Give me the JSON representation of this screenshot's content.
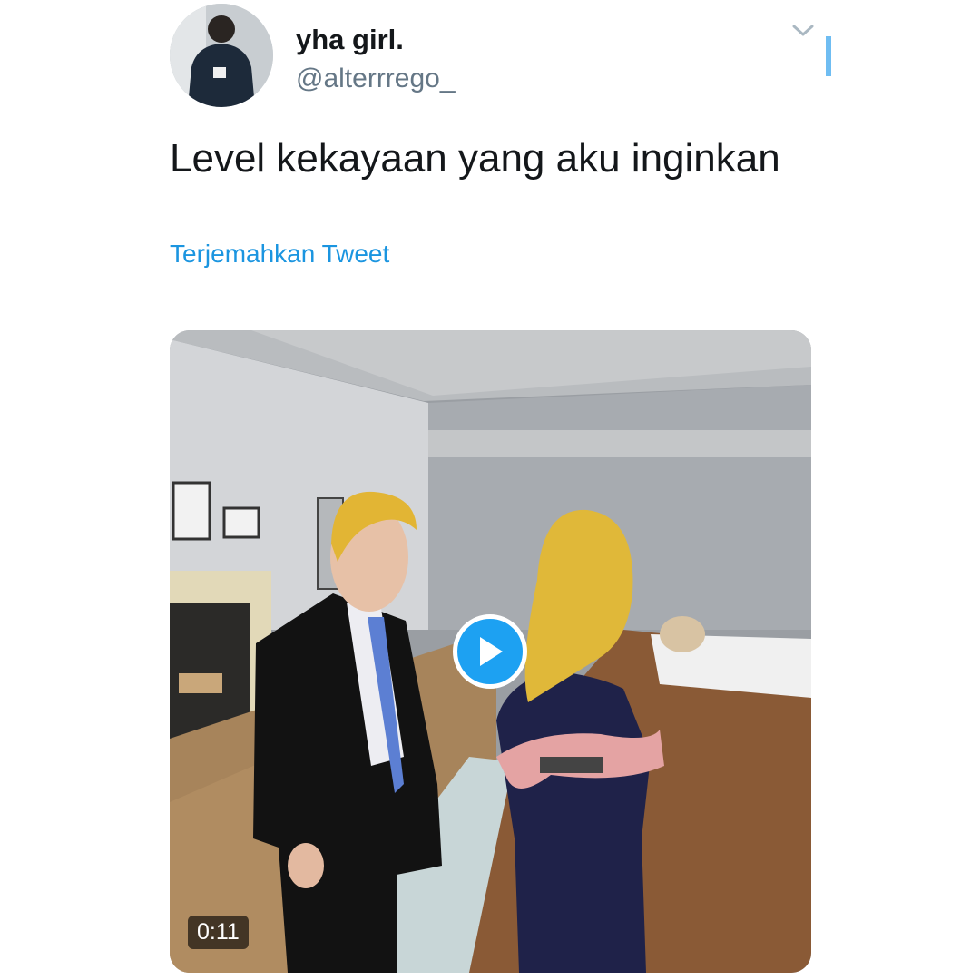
{
  "tweet": {
    "display_name": "yha girl.",
    "handle": "@alterrrego_",
    "text": "Level kekayaan yang aku inginkan",
    "translate_label": "Terjemahkan Tweet",
    "more_icon": "chevron-down-icon",
    "avatar_icon": "avatar"
  },
  "media": {
    "type": "video",
    "duration": "0:11",
    "play_icon": "play-icon"
  },
  "colors": {
    "link": "#1b95e0",
    "play_button": "#1da1f2",
    "text": "#14171a",
    "secondary_text": "#657786"
  }
}
